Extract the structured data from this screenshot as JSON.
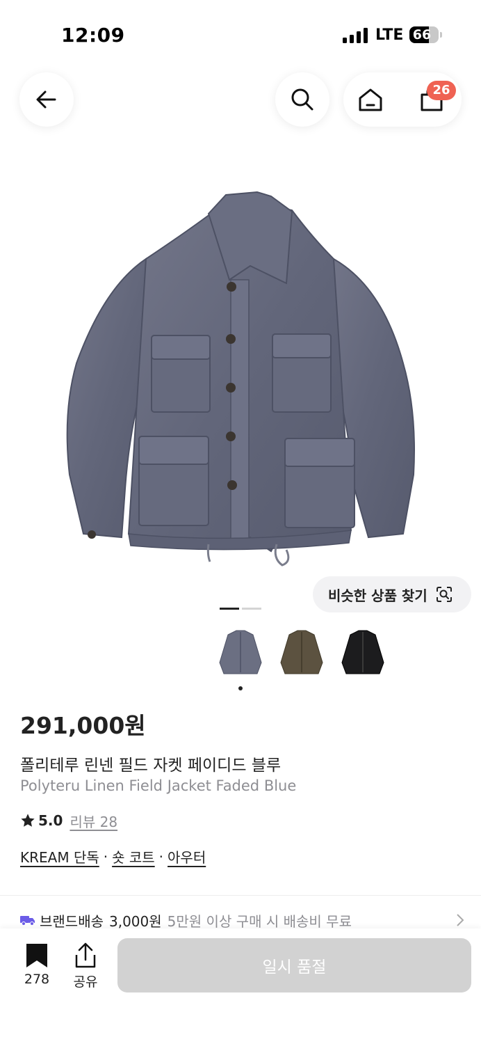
{
  "status_bar": {
    "time": "12:09",
    "network": "LTE",
    "battery_percent": "66",
    "battery_level": 0.66
  },
  "nav": {
    "back_icon": "arrow-left-icon",
    "search_icon": "search-icon",
    "home_icon": "home-icon",
    "cart_icon": "shopping-bag-icon",
    "cart_badge": "26",
    "badge_color": "#ef6253"
  },
  "product": {
    "image_carousel_pages": 2,
    "image_carousel_active_page": 1,
    "similar_button": "비슷한 상품 찾기",
    "color_options": [
      {
        "name": "faded-blue",
        "color": "#6b6f82",
        "selected": true
      },
      {
        "name": "olive",
        "color": "#5c5240",
        "selected": false
      },
      {
        "name": "black",
        "color": "#1c1c1e",
        "selected": false
      }
    ],
    "price": "291,000원",
    "title_ko": "폴리테루 린넨 필드 자켓 페이디드 블루",
    "title_en": "Polyteru Linen Field Jacket Faded Blue",
    "rating": "5.0",
    "review_label": "리뷰 28",
    "tags": [
      "KREAM 단독",
      "숏 코트",
      "아우터"
    ],
    "tag_separator": "·"
  },
  "shipping": {
    "label": "브랜드배송",
    "price": "3,000원",
    "note": "5만원 이상 구매 시 배송비 무료",
    "icon_color": "#6b5ce7"
  },
  "bottom_bar": {
    "bookmark_count": "278",
    "share_label": "공유",
    "cta_label": "일시 품절",
    "cta_color": "#d2d2d2"
  }
}
